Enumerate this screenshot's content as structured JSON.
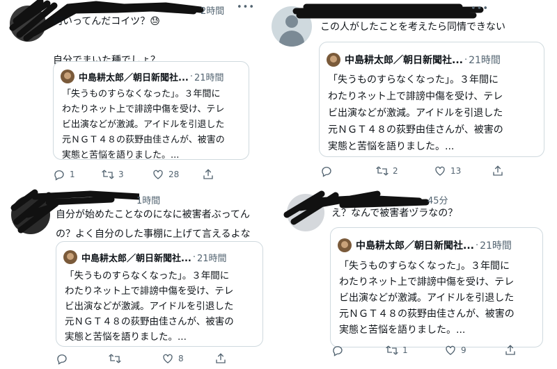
{
  "tweets": [
    {
      "time": "2時間",
      "body": "何いってんだコイツ？😓\n\n自分でまいた種でしょ？",
      "quote": {
        "name": "中島耕太郎／朝日新聞社...",
        "dot": "·",
        "time": "21時間",
        "text": "「失うものすらなくなった」。３年間に\nわたりネット上で誹謗中傷を受け、テレ\nビ出演などが激減。アイドルを引退した\n元ＮＧＴ４８の荻野由佳さんが、被害の\n実態と苦悩を語りました。..."
      },
      "replies": "1",
      "retweets": "3",
      "likes": "28"
    },
    {
      "time": "",
      "body": "この人がしたことを考えたら同情できない",
      "quote": {
        "name": "中島耕太郎／朝日新聞社...",
        "dot": "·",
        "time": "21時間",
        "text": "「失うものすらなくなった」。３年間に\nわたりネット上で誹謗中傷を受け、テレ\nビ出演などが激減。アイドルを引退した\n元ＮＧＴ４８の荻野由佳さんが、被害の\n実態と苦悩を語りました。..."
      },
      "replies": "",
      "retweets": "2",
      "likes": "13"
    },
    {
      "time": "1時間",
      "body": "自分が始めたことなのになに被害者ぶってん\nの？よく自分のした事棚に上げて言えるよな",
      "quote": {
        "name": "中島耕太郎／朝日新聞社...",
        "dot": "·",
        "time": "21時間",
        "text": "「失うものすらなくなった」。３年間に\nわたりネット上で誹謗中傷を受け、テレ\nビ出演などが激減。アイドルを引退した\n元ＮＧＴ４８の荻野由佳さんが、被害の\n実態と苦悩を語りました。..."
      },
      "replies": "",
      "retweets": "",
      "likes": "8"
    },
    {
      "time": "45分",
      "body": "え？なんで被害者ヅラなの？",
      "quote": {
        "name": "中島耕太郎／朝日新聞社...",
        "dot": "·",
        "time": "21時間",
        "text": "「失うものすらなくなった」。３年間に\nわたりネット上で誹謗中傷を受け、テレ\nビ出演などが激減。アイドルを引退した\n元ＮＧＴ４８の荻野由佳さんが、被害の\n実態と苦悩を語りました。..."
      },
      "replies": "",
      "retweets": "1",
      "likes": "9"
    }
  ],
  "more_icon": "•••",
  "icons": [
    "reply-icon",
    "retweet-icon",
    "like-icon",
    "share-icon"
  ]
}
